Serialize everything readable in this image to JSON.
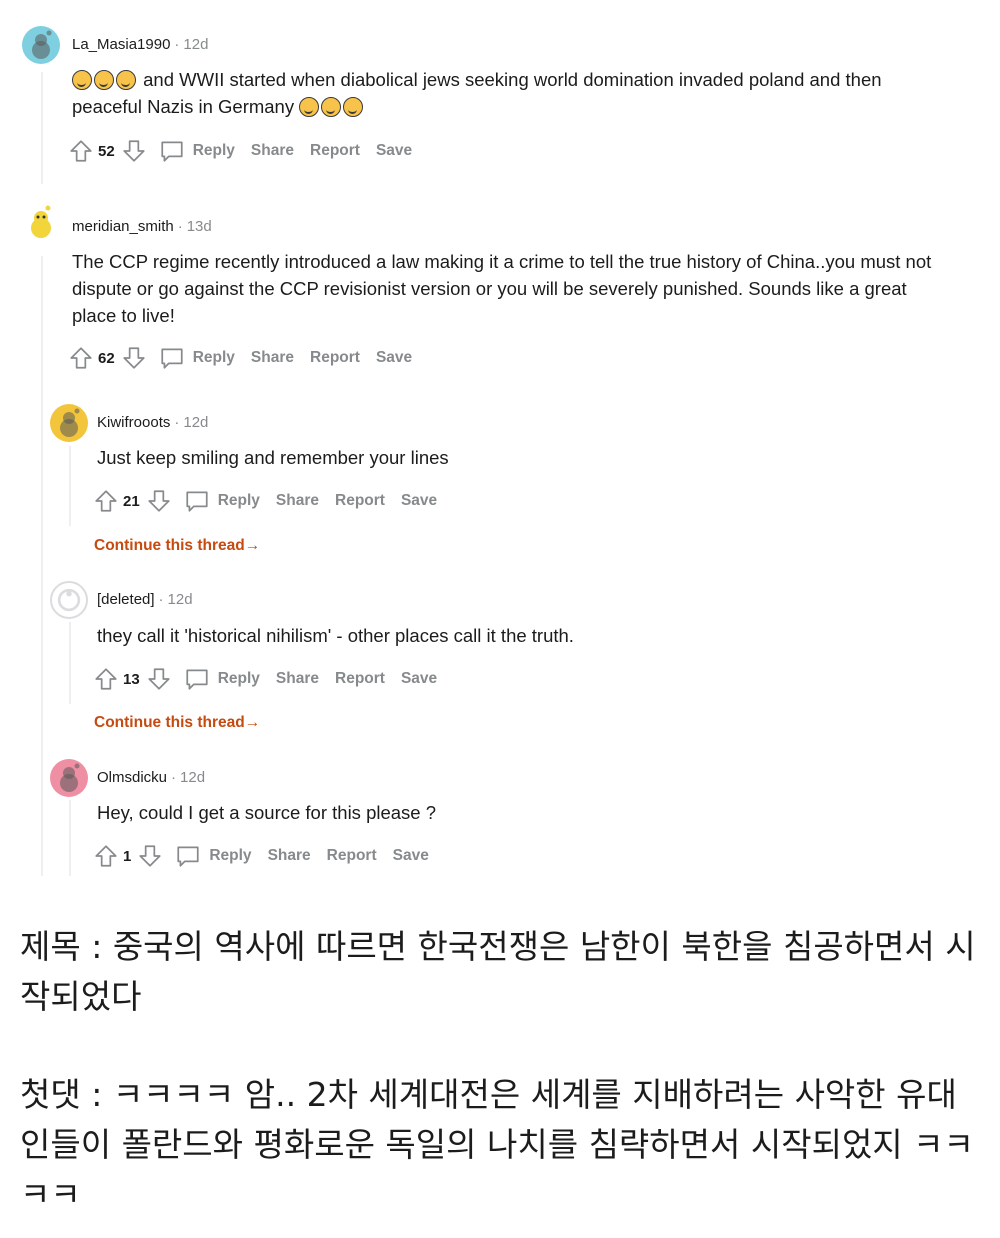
{
  "comments": [
    {
      "username": "La_Masia1990",
      "time": "12d",
      "text_after_emoji": "and WWII started when diabolical jews seeking world domination invaded poland and then",
      "text_line2": "peaceful Nazis in Germany",
      "votes": "52",
      "avatar_color": "#7ecfe0"
    },
    {
      "username": "meridian_smith",
      "time": "13d",
      "text": "The CCP regime recently introduced a law making it a crime to tell the true history of China..you must not dispute or go against the CCP revisionist version or you will be severely punished. Sounds like a great place to live!",
      "votes": "62",
      "avatar_color": "#f2d43b"
    },
    {
      "username": "Kiwifrooots",
      "time": "12d",
      "text": "Just keep smiling and remember your lines",
      "votes": "21",
      "avatar_color": "#f2c53a"
    },
    {
      "username": "[deleted]",
      "time": "12d",
      "text": "they call it 'historical nihilism' - other places call it the truth.",
      "votes": "13",
      "avatar_color": "#ffffff"
    },
    {
      "username": "Olmsdicku",
      "time": "12d",
      "text": "Hey, could I get a source for this please ?",
      "votes": "1",
      "avatar_color": "#ee8fa4"
    }
  ],
  "actions": {
    "reply": "Reply",
    "share": "Share",
    "report": "Report",
    "save": "Save"
  },
  "continue_thread": "Continue this thread",
  "continue_arrow": "→",
  "caption": {
    "title": "제목 : 중국의 역사에 따르면 한국전쟁은 남한이 북한을 침공하면서 시작되었다",
    "first_comment": "첫댓 : ㅋㅋㅋㅋ 암.. 2차 세계대전은 세계를 지배하려는 사악한 유대인들이 폴란드와 평화로운 독일의 나치를 침략하면서 시작되었지 ㅋㅋㅋㅋ"
  },
  "colors": {
    "meta_gray": "#878a8c",
    "continue_orange": "#c54b11",
    "thread_line": "#edeff1"
  }
}
